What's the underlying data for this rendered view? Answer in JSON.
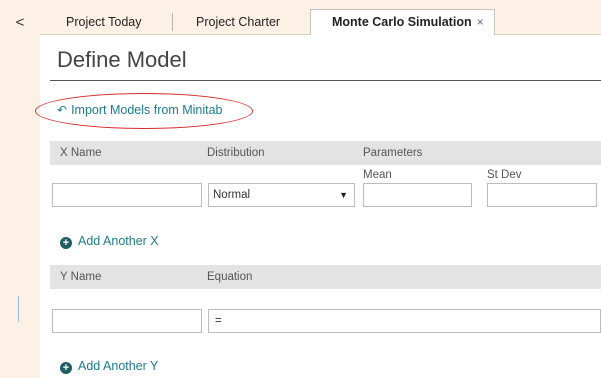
{
  "tabs": [
    {
      "label": "Project Today"
    },
    {
      "label": "Project Charter"
    },
    {
      "label": "Monte Carlo Simulation",
      "close": "×"
    }
  ],
  "nav": {
    "back_glyph": "<"
  },
  "page": {
    "title": "Define Model"
  },
  "import": {
    "label": "Import Models from Minitab",
    "icon": "undo-arrow-icon"
  },
  "x_section": {
    "headers": {
      "name": "X Name",
      "distribution": "Distribution",
      "parameters": "Parameters"
    },
    "param_labels": {
      "mean": "Mean",
      "stdev": "St Dev"
    },
    "row": {
      "name_value": "",
      "distribution_value": "Normal",
      "mean_value": "",
      "stdev_value": ""
    },
    "add_label": "Add Another X"
  },
  "y_section": {
    "headers": {
      "name": "Y Name",
      "equation": "Equation"
    },
    "row": {
      "name_value": "",
      "equation_value": "="
    },
    "add_label": "Add Another Y"
  },
  "colors": {
    "accent": "#1d7b8a",
    "highlight": "#d42b2b",
    "sidebar": "#fdf1e6"
  }
}
